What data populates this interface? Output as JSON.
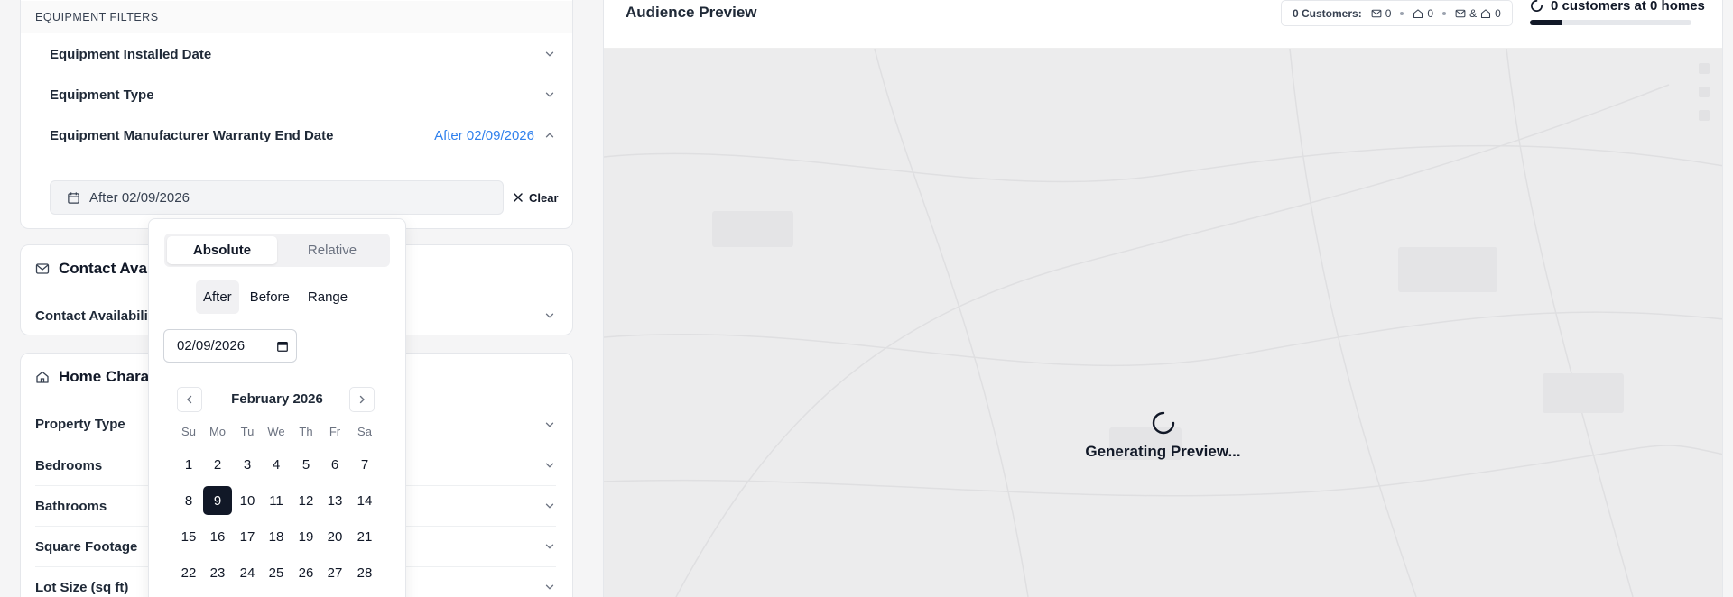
{
  "equipment": {
    "section_label": "EQUIPMENT FILTERS",
    "filters": [
      {
        "label": "Equipment Installed Date",
        "value": ""
      },
      {
        "label": "Equipment Type",
        "value": ""
      },
      {
        "label": "Equipment Manufacturer Warranty End Date",
        "value": "After 02/09/2026"
      }
    ],
    "date_display": "After 02/09/2026",
    "clear_label": "Clear"
  },
  "contact": {
    "title": "Contact Avail",
    "row_label": "Contact Availability"
  },
  "home": {
    "title": "Home Charac",
    "rows": [
      "Property Type",
      "Bedrooms",
      "Bathrooms",
      "Square Footage",
      "Lot Size (sq ft)"
    ]
  },
  "datepicker": {
    "tabs": [
      "Absolute",
      "Relative"
    ],
    "active_tab": "Absolute",
    "modes": [
      "After",
      "Before",
      "Range"
    ],
    "active_mode": "After",
    "input_value": "02/09/2026",
    "month_label": "February 2026",
    "weekdays": [
      "Su",
      "Mo",
      "Tu",
      "We",
      "Th",
      "Fr",
      "Sa"
    ],
    "weeks": [
      [
        "1",
        "2",
        "3",
        "4",
        "5",
        "6",
        "7"
      ],
      [
        "8",
        "9",
        "10",
        "11",
        "12",
        "13",
        "14"
      ],
      [
        "15",
        "16",
        "17",
        "18",
        "19",
        "20",
        "21"
      ],
      [
        "22",
        "23",
        "24",
        "25",
        "26",
        "27",
        "28"
      ]
    ],
    "selected_day": "9"
  },
  "preview": {
    "title": "Audience Preview",
    "stats_label": "0 Customers:",
    "email_count": "0",
    "home_count": "0",
    "both_sep": "&",
    "both_count": "0",
    "status_text": "0 customers at 0 homes",
    "progress_fraction": 0.2,
    "loading_text": "Generating Preview..."
  },
  "icons": {
    "chevron": "chevron-down-icon",
    "calendar": "calendar-icon",
    "close": "close-icon",
    "mail": "mail-icon",
    "home": "home-icon",
    "spinner": "spinner-icon"
  }
}
